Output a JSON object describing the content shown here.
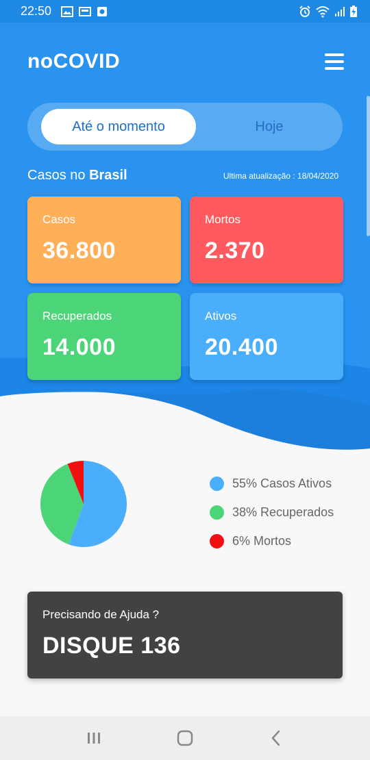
{
  "status_bar": {
    "time": "22:50",
    "left_icons": [
      "image-icon",
      "cast-icon",
      "shield-icon"
    ],
    "right_icons": [
      "alarm-icon",
      "wifi-icon",
      "signal-icon",
      "battery-icon"
    ]
  },
  "app": {
    "title": "noCOVID",
    "menu_icon": "menu-icon"
  },
  "tabs": {
    "active": "Até o momento",
    "inactive": "Hoje"
  },
  "summary": {
    "heading_prefix": "Casos no",
    "heading_country": "Brasil",
    "last_update": "Ultima atualização : 18/04/2020"
  },
  "cards": {
    "casos": {
      "label": "Casos",
      "value": "36.800"
    },
    "mortos": {
      "label": "Mortos",
      "value": "2.370"
    },
    "recuperados": {
      "label": "Recuperados",
      "value": "14.000"
    },
    "ativos": {
      "label": "Ativos",
      "value": "20.400"
    }
  },
  "chart_data": {
    "type": "pie",
    "slices": [
      {
        "label": "55% Casos Ativos",
        "value": 55,
        "color": "#4aaefb"
      },
      {
        "label": "38% Recuperados",
        "value": 38,
        "color": "#4cd478"
      },
      {
        "label": "6% Mortos",
        "value": 6,
        "color": "#f01010"
      }
    ]
  },
  "help": {
    "label": "Precisando de Ajuda ?",
    "value": "DISQUE 136"
  },
  "nav": {
    "items": [
      "recent-apps-icon",
      "home-icon",
      "back-icon"
    ]
  },
  "colors": {
    "primary": "#1e88e5",
    "casos": "#ffaf58",
    "mortos": "#ff5a5f",
    "recuperados": "#4cd478",
    "ativos": "#4aaefb",
    "help_bg": "#424242"
  }
}
